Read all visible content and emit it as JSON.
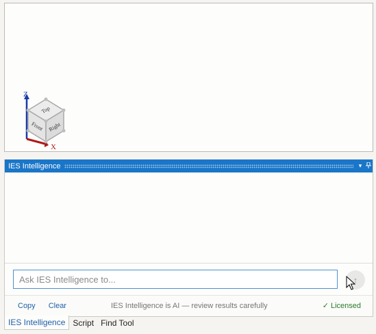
{
  "viewport": {
    "axis_z": "Z",
    "axis_x": "X",
    "cube_faces": {
      "top": "Top",
      "front": "Front",
      "right": "Right"
    }
  },
  "panel": {
    "title": "IES Intelligence",
    "dropdown_icon": "chevron-down-icon",
    "pin_icon": "pin-icon"
  },
  "chat": {
    "input_placeholder": "Ask IES Intelligence to...",
    "input_value": "",
    "send_icon": "send-arrow-icon"
  },
  "footer": {
    "copy_label": "Copy",
    "clear_label": "Clear",
    "ai_notice": "IES Intelligence is AI — review results carefully",
    "license_status": "✓ Licensed"
  },
  "tabs": [
    {
      "label": "IES Intelligence",
      "active": true
    },
    {
      "label": "Script",
      "active": false
    },
    {
      "label": "Find Tool",
      "active": false
    }
  ],
  "colors": {
    "accent": "#1a76c8",
    "link": "#1f5fa8",
    "licensed": "#2a7a2a",
    "axis_z": "#1a3aa8",
    "axis_x": "#b01818"
  }
}
